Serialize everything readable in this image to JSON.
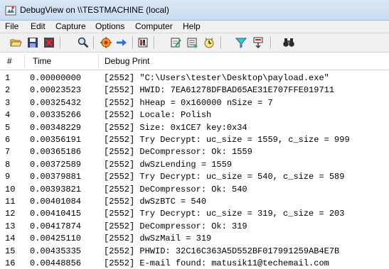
{
  "window": {
    "title": "DebugView on \\\\TESTMACHINE (local)"
  },
  "menu": [
    {
      "label": "File"
    },
    {
      "label": "Edit"
    },
    {
      "label": "Capture"
    },
    {
      "label": "Options"
    },
    {
      "label": "Computer"
    },
    {
      "label": "Help"
    }
  ],
  "toolbar": {
    "buttons": [
      {
        "icon": "open-folder-icon"
      },
      {
        "icon": "save-icon"
      },
      {
        "icon": "clear-icon"
      },
      {
        "icon": "find-icon"
      },
      {
        "icon": "capture-icon"
      },
      {
        "icon": "autoscroll-arrow-icon"
      },
      {
        "icon": "history-icon"
      },
      {
        "icon": "edit-filter-icon"
      },
      {
        "icon": "properties-icon"
      },
      {
        "icon": "clock-icon"
      },
      {
        "icon": "filter-icon"
      },
      {
        "icon": "highlight-icon"
      },
      {
        "icon": "binoculars-icon"
      }
    ]
  },
  "columns": {
    "num": "#",
    "time": "Time",
    "print": "Debug Print"
  },
  "rows": [
    {
      "num": "1",
      "time": "0.00000000",
      "print": "[2552] \"C:\\Users\\tester\\Desktop\\payload.exe\""
    },
    {
      "num": "2",
      "time": "0.00023523",
      "print": "[2552] HWID: 7EA61278DFBAD65AE31E707FFE019711"
    },
    {
      "num": "3",
      "time": "0.00325432",
      "print": "[2552] hHeap = 0x160000 nSize = 7"
    },
    {
      "num": "4",
      "time": "0.00335266",
      "print": "[2552] Locale: Polish"
    },
    {
      "num": "5",
      "time": "0.00348229",
      "print": "[2552] Size: 0x1CE7 key:0x34"
    },
    {
      "num": "6",
      "time": "0.00356191",
      "print": "[2552] Try Decrypt: uc_size = 1559, c_size = 999"
    },
    {
      "num": "7",
      "time": "0.00365186",
      "print": "[2552] DeCompressor: Ok: 1559"
    },
    {
      "num": "8",
      "time": "0.00372589",
      "print": "[2552] dwSzLending = 1559"
    },
    {
      "num": "9",
      "time": "0.00379881",
      "print": "[2552] Try Decrypt: uc_size = 540, c_size = 589"
    },
    {
      "num": "10",
      "time": "0.00393821",
      "print": "[2552] DeCompressor: Ok: 540"
    },
    {
      "num": "11",
      "time": "0.00401084",
      "print": "[2552] dwSzBTC = 540"
    },
    {
      "num": "12",
      "time": "0.00410415",
      "print": "[2552] Try Decrypt: uc_size = 319, c_size = 203"
    },
    {
      "num": "13",
      "time": "0.00417874",
      "print": "[2552] DeCompressor: Ok: 319"
    },
    {
      "num": "14",
      "time": "0.00425110",
      "print": "[2552] dwSzMail = 319"
    },
    {
      "num": "15",
      "time": "0.00435335",
      "print": "[2552] PHWID: 32C16C363A5D552BF017991259AB4E7B"
    },
    {
      "num": "16",
      "time": "0.00448856",
      "print": "[2552] E-mail found: matusik11@techemail.com"
    }
  ]
}
